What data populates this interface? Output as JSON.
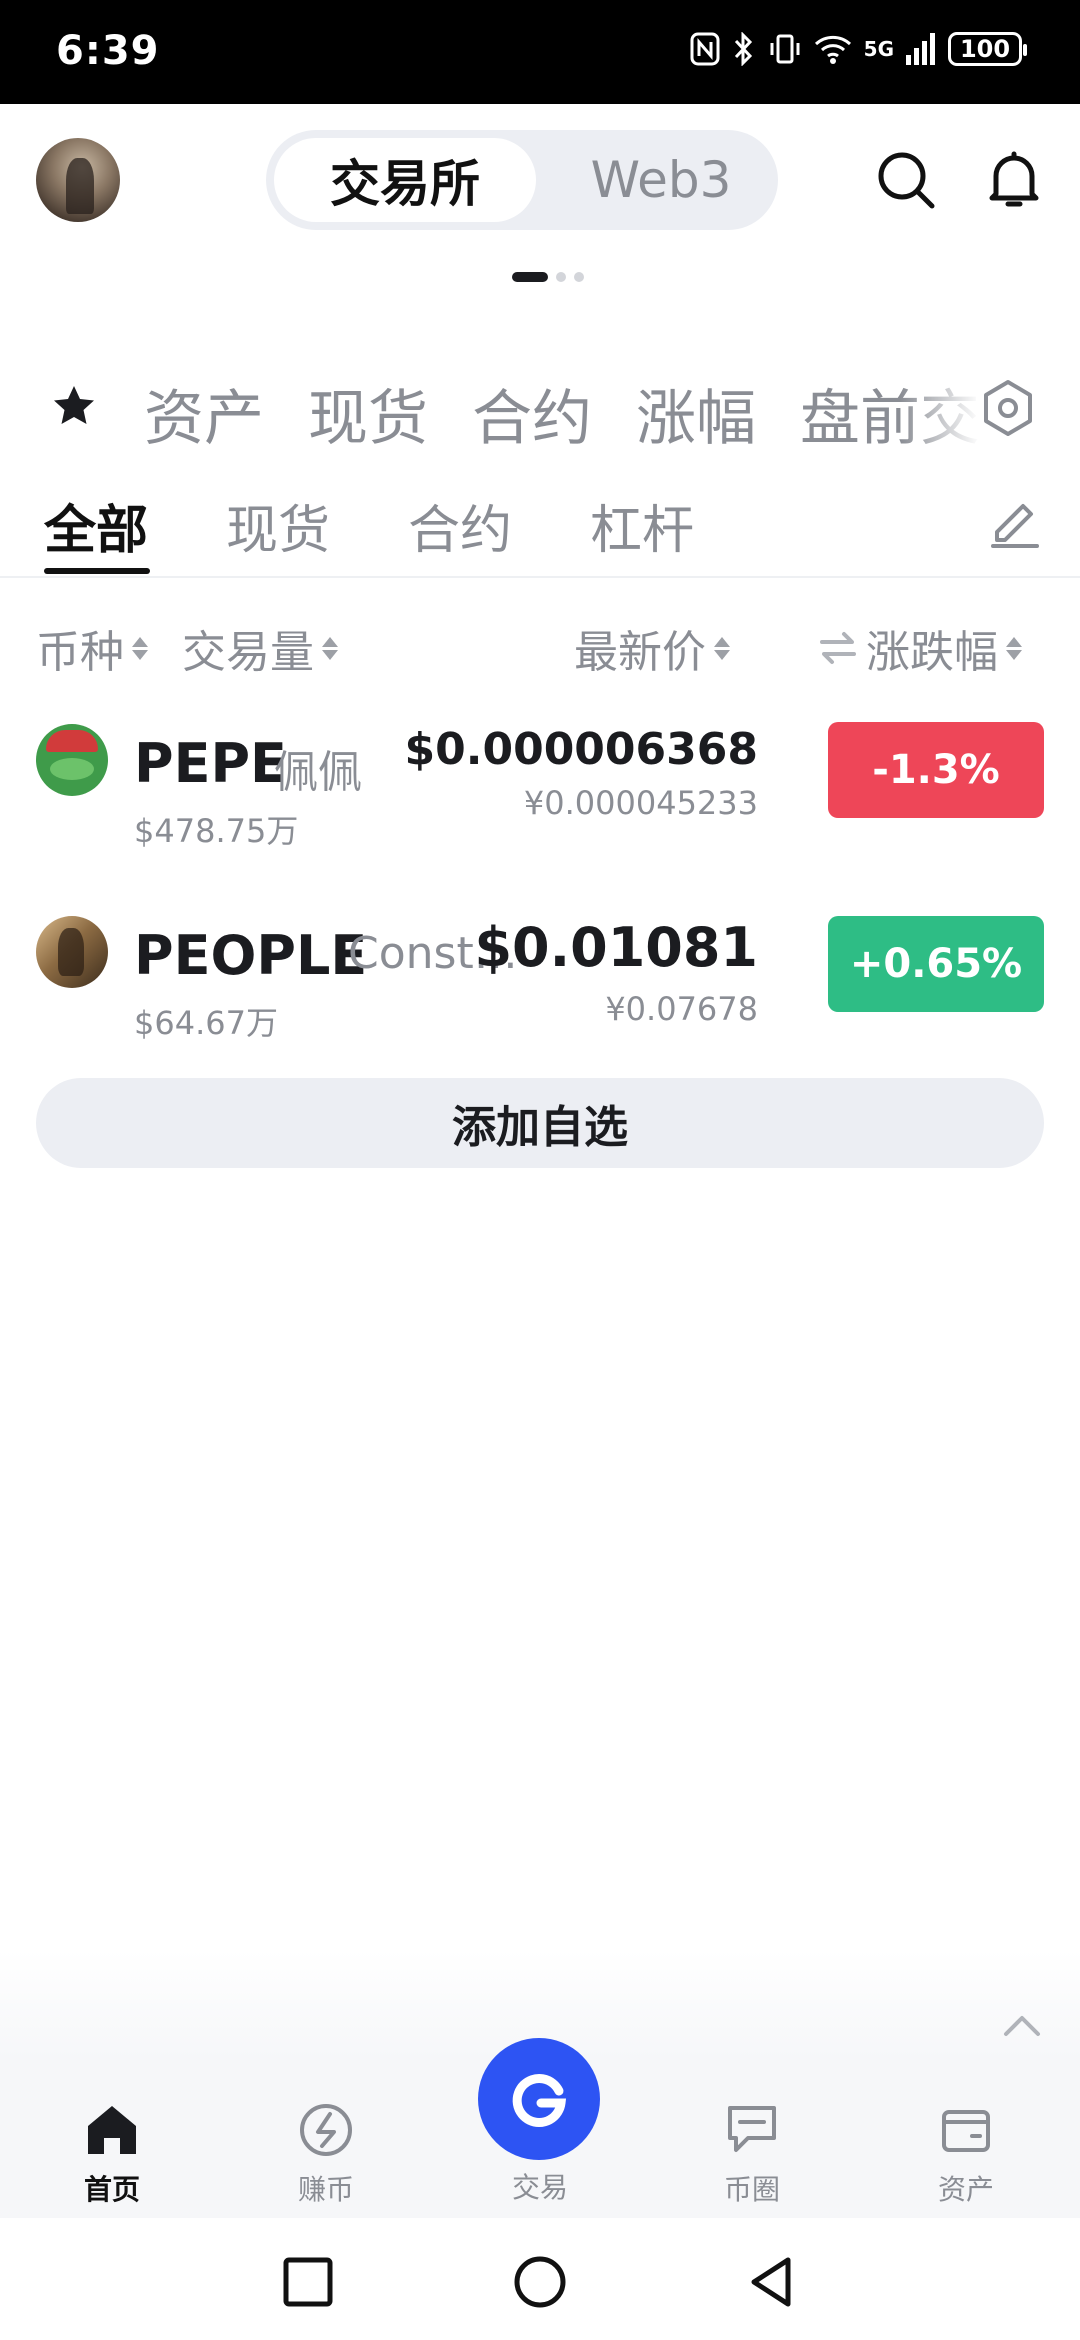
{
  "status_bar": {
    "time": "6:39",
    "network": "5G",
    "battery": "100"
  },
  "header": {
    "mode_active": "交易所",
    "mode_inactive": "Web3",
    "search_icon": "search-icon",
    "bell_icon": "bell-icon"
  },
  "category_tabs": [
    "资产",
    "现货",
    "合约",
    "涨幅",
    "盘前交"
  ],
  "sub_tabs": [
    "全部",
    "现货",
    "合约",
    "杠杆"
  ],
  "columns": {
    "coin": "币种",
    "volume": "交易量",
    "price": "最新价",
    "change": "涨跌幅"
  },
  "rows": [
    {
      "symbol": "PEPE",
      "name": "佩佩",
      "volume": "$478.75万",
      "price": "$0.000006368",
      "price_cny": "¥0.000045233",
      "change": "-1.3%",
      "change_color": "#ee4658"
    },
    {
      "symbol": "PEOPLE",
      "name": "Const…",
      "volume": "$64.67万",
      "price": "$0.01081",
      "price_cny": "¥0.07678",
      "change": "+0.65%",
      "change_color": "#2ebd85"
    }
  ],
  "add_watchlist": "添加自选",
  "bottom_nav": [
    {
      "label": "首页",
      "icon": "home-icon"
    },
    {
      "label": "赚币",
      "icon": "earn-icon"
    },
    {
      "label": "交易",
      "icon": "trade-icon"
    },
    {
      "label": "币圈",
      "icon": "community-icon"
    },
    {
      "label": "资产",
      "icon": "wallet-icon"
    }
  ],
  "colors": {
    "accent": "#2d54f3",
    "down": "#ee4658",
    "up": "#2ebd85"
  }
}
